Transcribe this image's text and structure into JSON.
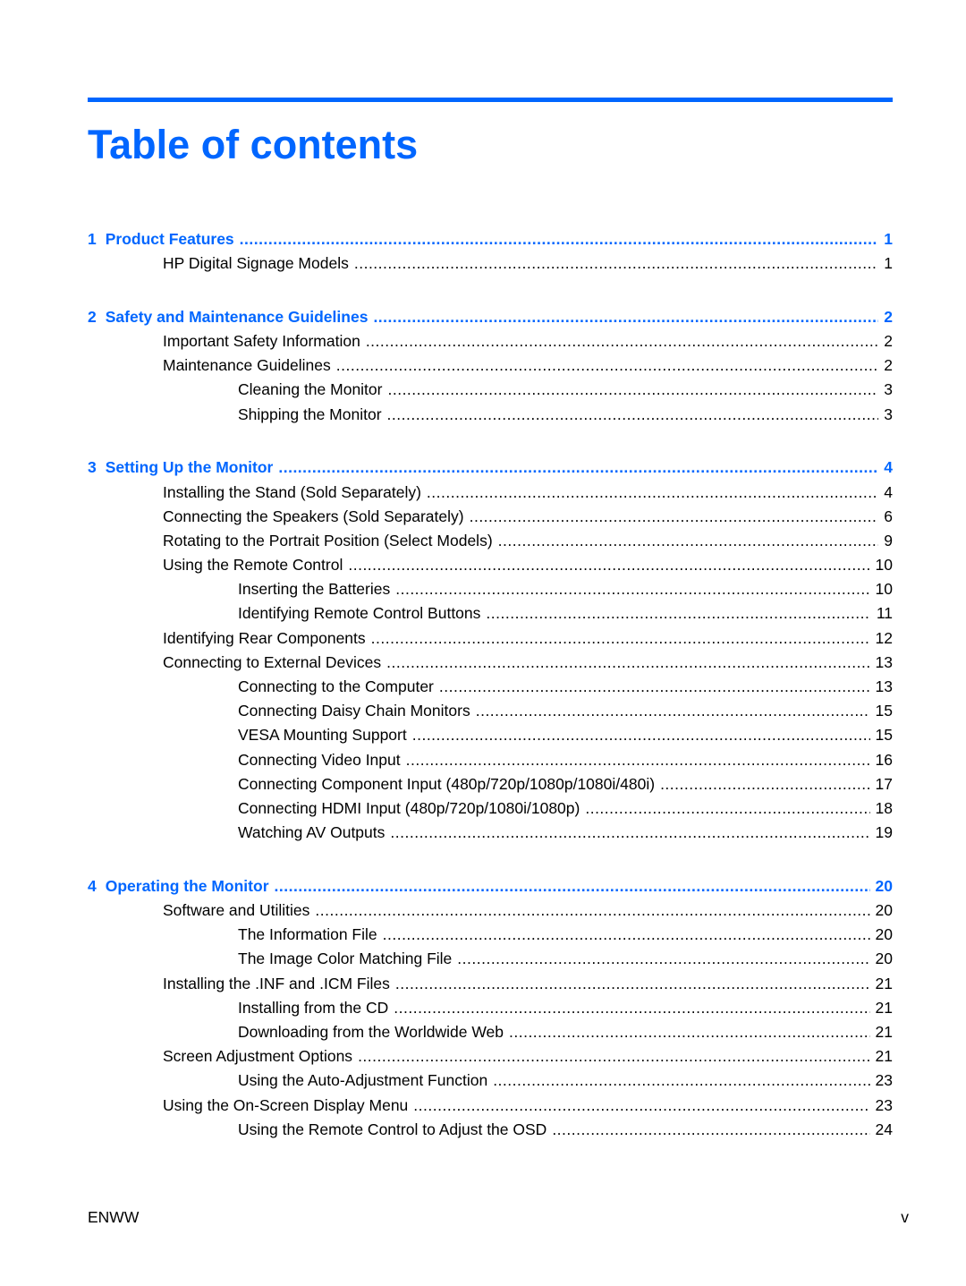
{
  "heading": "Table of contents",
  "accent_color": "#0066ff",
  "chapters": [
    {
      "number": "1",
      "title": "Product Features",
      "page": "1",
      "entries": [
        {
          "level": 2,
          "title": "HP Digital Signage Models",
          "page": "1"
        }
      ]
    },
    {
      "number": "2",
      "title": "Safety and Maintenance Guidelines",
      "page": "2",
      "entries": [
        {
          "level": 2,
          "title": "Important Safety Information",
          "page": "2"
        },
        {
          "level": 2,
          "title": "Maintenance Guidelines",
          "page": "2"
        },
        {
          "level": 3,
          "title": "Cleaning the Monitor",
          "page": "3"
        },
        {
          "level": 3,
          "title": "Shipping the Monitor",
          "page": "3"
        }
      ]
    },
    {
      "number": "3",
      "title": "Setting Up the Monitor",
      "page": "4",
      "entries": [
        {
          "level": 2,
          "title": "Installing the Stand (Sold Separately)",
          "page": "4"
        },
        {
          "level": 2,
          "title": "Connecting the Speakers (Sold Separately)",
          "page": "6"
        },
        {
          "level": 2,
          "title": "Rotating to the Portrait Position (Select Models)",
          "page": "9"
        },
        {
          "level": 2,
          "title": "Using the Remote Control",
          "page": "10"
        },
        {
          "level": 3,
          "title": "Inserting the Batteries",
          "page": "10"
        },
        {
          "level": 3,
          "title": "Identifying Remote Control Buttons",
          "page": "11"
        },
        {
          "level": 2,
          "title": "Identifying Rear Components",
          "page": "12"
        },
        {
          "level": 2,
          "title": "Connecting to External Devices",
          "page": "13"
        },
        {
          "level": 3,
          "title": "Connecting to the Computer",
          "page": "13"
        },
        {
          "level": 3,
          "title": "Connecting Daisy Chain Monitors",
          "page": "15"
        },
        {
          "level": 3,
          "title": "VESA Mounting Support",
          "page": "15"
        },
        {
          "level": 3,
          "title": "Connecting Video Input",
          "page": "16"
        },
        {
          "level": 3,
          "title": "Connecting Component Input (480p/720p/1080p/1080i/480i)",
          "page": "17"
        },
        {
          "level": 3,
          "title": "Connecting HDMI Input (480p/720p/1080i/1080p)",
          "page": "18"
        },
        {
          "level": 3,
          "title": "Watching AV Outputs",
          "page": "19"
        }
      ]
    },
    {
      "number": "4",
      "title": "Operating the Monitor",
      "page": "20",
      "entries": [
        {
          "level": 2,
          "title": "Software and Utilities",
          "page": "20"
        },
        {
          "level": 3,
          "title": "The Information File",
          "page": "20"
        },
        {
          "level": 3,
          "title": "The Image Color Matching File",
          "page": "20"
        },
        {
          "level": 2,
          "title": "Installing the .INF and .ICM Files",
          "page": "21"
        },
        {
          "level": 3,
          "title": "Installing from the CD",
          "page": "21"
        },
        {
          "level": 3,
          "title": "Downloading from the Worldwide Web",
          "page": "21"
        },
        {
          "level": 2,
          "title": "Screen Adjustment Options",
          "page": "21"
        },
        {
          "level": 3,
          "title": "Using the Auto-Adjustment Function",
          "page": "23"
        },
        {
          "level": 2,
          "title": "Using the On-Screen Display Menu",
          "page": "23"
        },
        {
          "level": 3,
          "title": "Using the Remote Control to Adjust the OSD",
          "page": "24"
        }
      ]
    }
  ],
  "footer": {
    "left": "ENWW",
    "right": "v"
  }
}
